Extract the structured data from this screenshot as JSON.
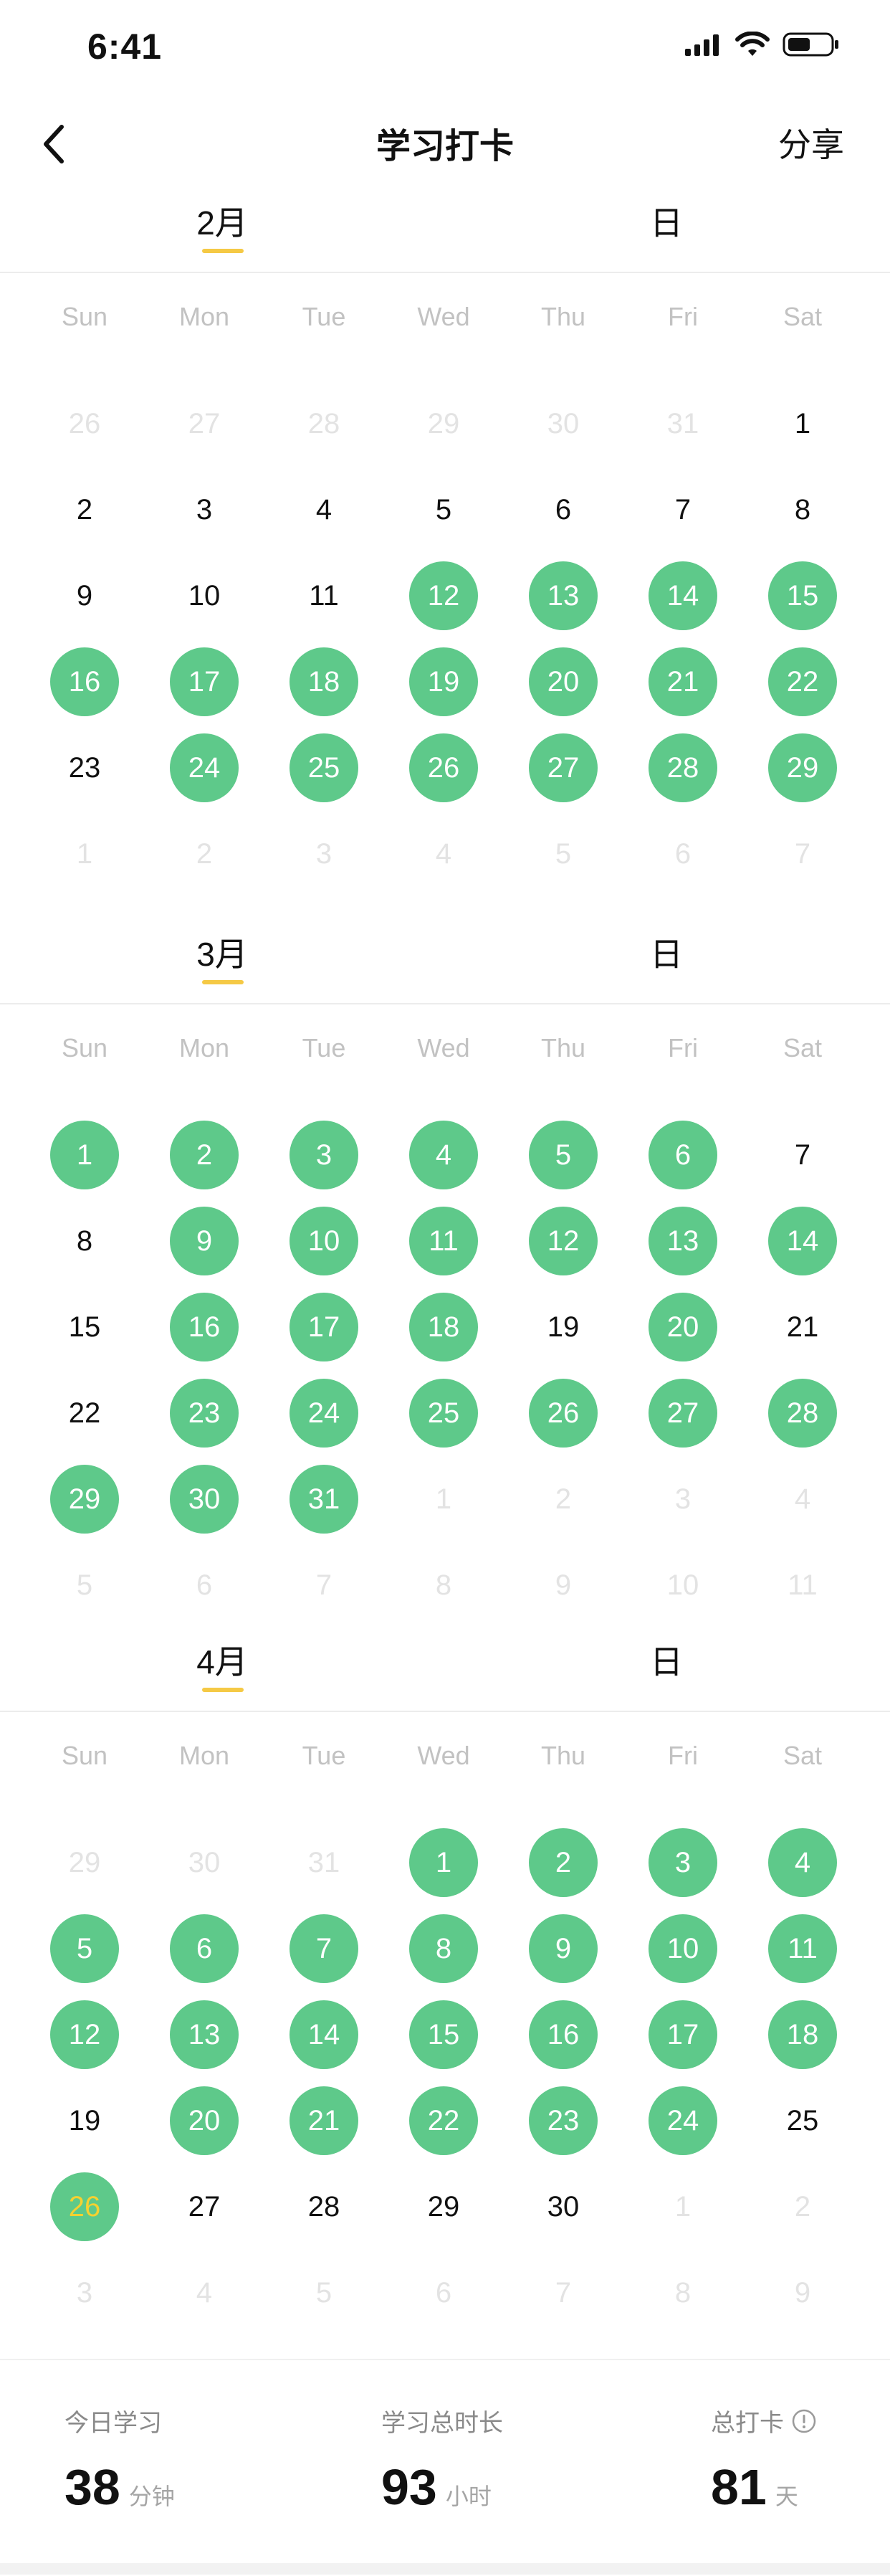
{
  "status_bar": {
    "time": "6:41"
  },
  "nav": {
    "title": "学习打卡",
    "share": "分享"
  },
  "weekdays": [
    "Sun",
    "Mon",
    "Tue",
    "Wed",
    "Thu",
    "Fri",
    "Sat"
  ],
  "months": [
    {
      "month_label": "2月",
      "day_label": "日",
      "weeks": [
        [
          {
            "d": "26",
            "s": "other"
          },
          {
            "d": "27",
            "s": "other"
          },
          {
            "d": "28",
            "s": "other"
          },
          {
            "d": "29",
            "s": "other"
          },
          {
            "d": "30",
            "s": "other"
          },
          {
            "d": "31",
            "s": "other"
          },
          {
            "d": "1",
            "s": "normal"
          }
        ],
        [
          {
            "d": "2",
            "s": "normal"
          },
          {
            "d": "3",
            "s": "normal"
          },
          {
            "d": "4",
            "s": "normal"
          },
          {
            "d": "5",
            "s": "normal"
          },
          {
            "d": "6",
            "s": "normal"
          },
          {
            "d": "7",
            "s": "normal"
          },
          {
            "d": "8",
            "s": "normal"
          }
        ],
        [
          {
            "d": "9",
            "s": "normal"
          },
          {
            "d": "10",
            "s": "normal"
          },
          {
            "d": "11",
            "s": "normal"
          },
          {
            "d": "12",
            "s": "checked"
          },
          {
            "d": "13",
            "s": "checked"
          },
          {
            "d": "14",
            "s": "checked"
          },
          {
            "d": "15",
            "s": "checked"
          }
        ],
        [
          {
            "d": "16",
            "s": "checked"
          },
          {
            "d": "17",
            "s": "checked"
          },
          {
            "d": "18",
            "s": "checked"
          },
          {
            "d": "19",
            "s": "checked"
          },
          {
            "d": "20",
            "s": "checked"
          },
          {
            "d": "21",
            "s": "checked"
          },
          {
            "d": "22",
            "s": "checked"
          }
        ],
        [
          {
            "d": "23",
            "s": "normal"
          },
          {
            "d": "24",
            "s": "checked"
          },
          {
            "d": "25",
            "s": "checked"
          },
          {
            "d": "26",
            "s": "checked"
          },
          {
            "d": "27",
            "s": "checked"
          },
          {
            "d": "28",
            "s": "checked"
          },
          {
            "d": "29",
            "s": "checked"
          }
        ],
        [
          {
            "d": "1",
            "s": "other"
          },
          {
            "d": "2",
            "s": "other"
          },
          {
            "d": "3",
            "s": "other"
          },
          {
            "d": "4",
            "s": "other"
          },
          {
            "d": "5",
            "s": "other"
          },
          {
            "d": "6",
            "s": "other"
          },
          {
            "d": "7",
            "s": "other"
          }
        ]
      ]
    },
    {
      "month_label": "3月",
      "day_label": "日",
      "weeks": [
        [
          {
            "d": "1",
            "s": "checked"
          },
          {
            "d": "2",
            "s": "checked"
          },
          {
            "d": "3",
            "s": "checked"
          },
          {
            "d": "4",
            "s": "checked"
          },
          {
            "d": "5",
            "s": "checked"
          },
          {
            "d": "6",
            "s": "checked"
          },
          {
            "d": "7",
            "s": "normal"
          }
        ],
        [
          {
            "d": "8",
            "s": "normal"
          },
          {
            "d": "9",
            "s": "checked"
          },
          {
            "d": "10",
            "s": "checked"
          },
          {
            "d": "11",
            "s": "checked"
          },
          {
            "d": "12",
            "s": "checked"
          },
          {
            "d": "13",
            "s": "checked"
          },
          {
            "d": "14",
            "s": "checked"
          }
        ],
        [
          {
            "d": "15",
            "s": "normal"
          },
          {
            "d": "16",
            "s": "checked"
          },
          {
            "d": "17",
            "s": "checked"
          },
          {
            "d": "18",
            "s": "checked"
          },
          {
            "d": "19",
            "s": "normal"
          },
          {
            "d": "20",
            "s": "checked"
          },
          {
            "d": "21",
            "s": "normal"
          }
        ],
        [
          {
            "d": "22",
            "s": "normal"
          },
          {
            "d": "23",
            "s": "checked"
          },
          {
            "d": "24",
            "s": "checked"
          },
          {
            "d": "25",
            "s": "checked"
          },
          {
            "d": "26",
            "s": "checked"
          },
          {
            "d": "27",
            "s": "checked"
          },
          {
            "d": "28",
            "s": "checked"
          }
        ],
        [
          {
            "d": "29",
            "s": "checked"
          },
          {
            "d": "30",
            "s": "checked"
          },
          {
            "d": "31",
            "s": "checked"
          },
          {
            "d": "1",
            "s": "other"
          },
          {
            "d": "2",
            "s": "other"
          },
          {
            "d": "3",
            "s": "other"
          },
          {
            "d": "4",
            "s": "other"
          }
        ],
        [
          {
            "d": "5",
            "s": "other"
          },
          {
            "d": "6",
            "s": "other"
          },
          {
            "d": "7",
            "s": "other"
          },
          {
            "d": "8",
            "s": "other"
          },
          {
            "d": "9",
            "s": "other"
          },
          {
            "d": "10",
            "s": "other"
          },
          {
            "d": "11",
            "s": "other"
          }
        ]
      ]
    },
    {
      "month_label": "4月",
      "day_label": "日",
      "weeks": [
        [
          {
            "d": "29",
            "s": "other"
          },
          {
            "d": "30",
            "s": "other"
          },
          {
            "d": "31",
            "s": "other"
          },
          {
            "d": "1",
            "s": "checked"
          },
          {
            "d": "2",
            "s": "checked"
          },
          {
            "d": "3",
            "s": "checked"
          },
          {
            "d": "4",
            "s": "checked"
          }
        ],
        [
          {
            "d": "5",
            "s": "checked"
          },
          {
            "d": "6",
            "s": "checked"
          },
          {
            "d": "7",
            "s": "checked"
          },
          {
            "d": "8",
            "s": "checked"
          },
          {
            "d": "9",
            "s": "checked"
          },
          {
            "d": "10",
            "s": "checked"
          },
          {
            "d": "11",
            "s": "checked"
          }
        ],
        [
          {
            "d": "12",
            "s": "checked"
          },
          {
            "d": "13",
            "s": "checked"
          },
          {
            "d": "14",
            "s": "checked"
          },
          {
            "d": "15",
            "s": "checked"
          },
          {
            "d": "16",
            "s": "checked"
          },
          {
            "d": "17",
            "s": "checked"
          },
          {
            "d": "18",
            "s": "checked"
          }
        ],
        [
          {
            "d": "19",
            "s": "normal"
          },
          {
            "d": "20",
            "s": "checked"
          },
          {
            "d": "21",
            "s": "checked"
          },
          {
            "d": "22",
            "s": "checked"
          },
          {
            "d": "23",
            "s": "checked"
          },
          {
            "d": "24",
            "s": "checked"
          },
          {
            "d": "25",
            "s": "normal"
          }
        ],
        [
          {
            "d": "26",
            "s": "today-checked"
          },
          {
            "d": "27",
            "s": "normal"
          },
          {
            "d": "28",
            "s": "normal"
          },
          {
            "d": "29",
            "s": "normal"
          },
          {
            "d": "30",
            "s": "normal"
          },
          {
            "d": "1",
            "s": "other"
          },
          {
            "d": "2",
            "s": "other"
          }
        ],
        [
          {
            "d": "3",
            "s": "other"
          },
          {
            "d": "4",
            "s": "other"
          },
          {
            "d": "5",
            "s": "other"
          },
          {
            "d": "6",
            "s": "other"
          },
          {
            "d": "7",
            "s": "other"
          },
          {
            "d": "8",
            "s": "other"
          },
          {
            "d": "9",
            "s": "other"
          }
        ]
      ]
    }
  ],
  "stats": {
    "today": {
      "label": "今日学习",
      "value": "38",
      "unit": "分钟"
    },
    "total_time": {
      "label": "学习总时长",
      "value": "93",
      "unit": "小时"
    },
    "total_checkin": {
      "label": "总打卡",
      "value": "81",
      "unit": "天"
    }
  },
  "colors": {
    "checked": "#5ec98a",
    "accent": "#f5c945",
    "today_text": "#f5d130",
    "other_month": "#e3e3e3"
  },
  "icons": [
    "back-arrow-icon",
    "cellular-signal-icon",
    "wifi-icon",
    "battery-icon",
    "info-icon"
  ]
}
